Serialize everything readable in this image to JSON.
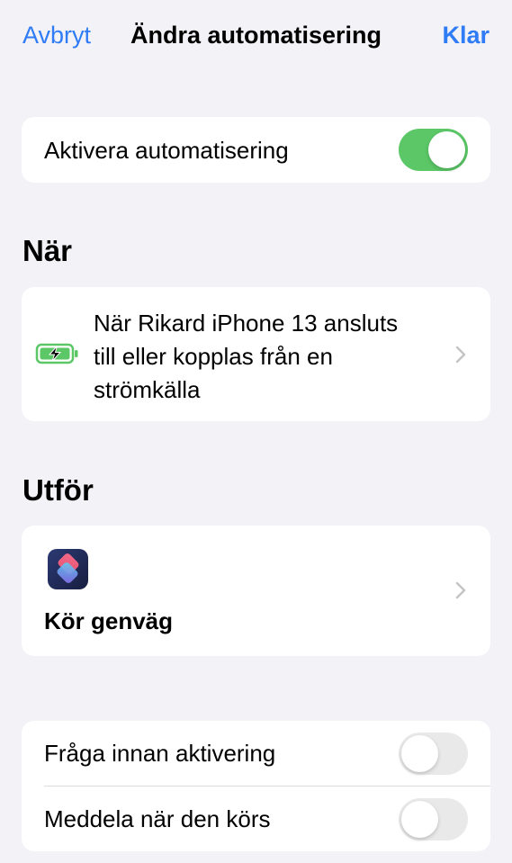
{
  "nav": {
    "cancel_label": "Avbryt",
    "title": "Ändra automatisering",
    "done_label": "Klar"
  },
  "enable": {
    "label": "Aktivera automatisering",
    "on": true
  },
  "when": {
    "header": "När",
    "trigger_lines": [
      "När Rikard iPhone 13 ansluts",
      "till eller kopplas från en",
      "strömkälla"
    ],
    "icon": "battery-charging-icon"
  },
  "do": {
    "header": "Utför",
    "action_label": "Kör genväg",
    "icon": "shortcuts-app-icon"
  },
  "options": [
    {
      "label": "Fråga innan aktivering",
      "on": false
    },
    {
      "label": "Meddela när den körs",
      "on": false
    }
  ],
  "colors": {
    "accent": "#2f7cf6",
    "toggle_on": "#5bc767",
    "battery": "#5bc767",
    "background": "#f2f2f7"
  }
}
